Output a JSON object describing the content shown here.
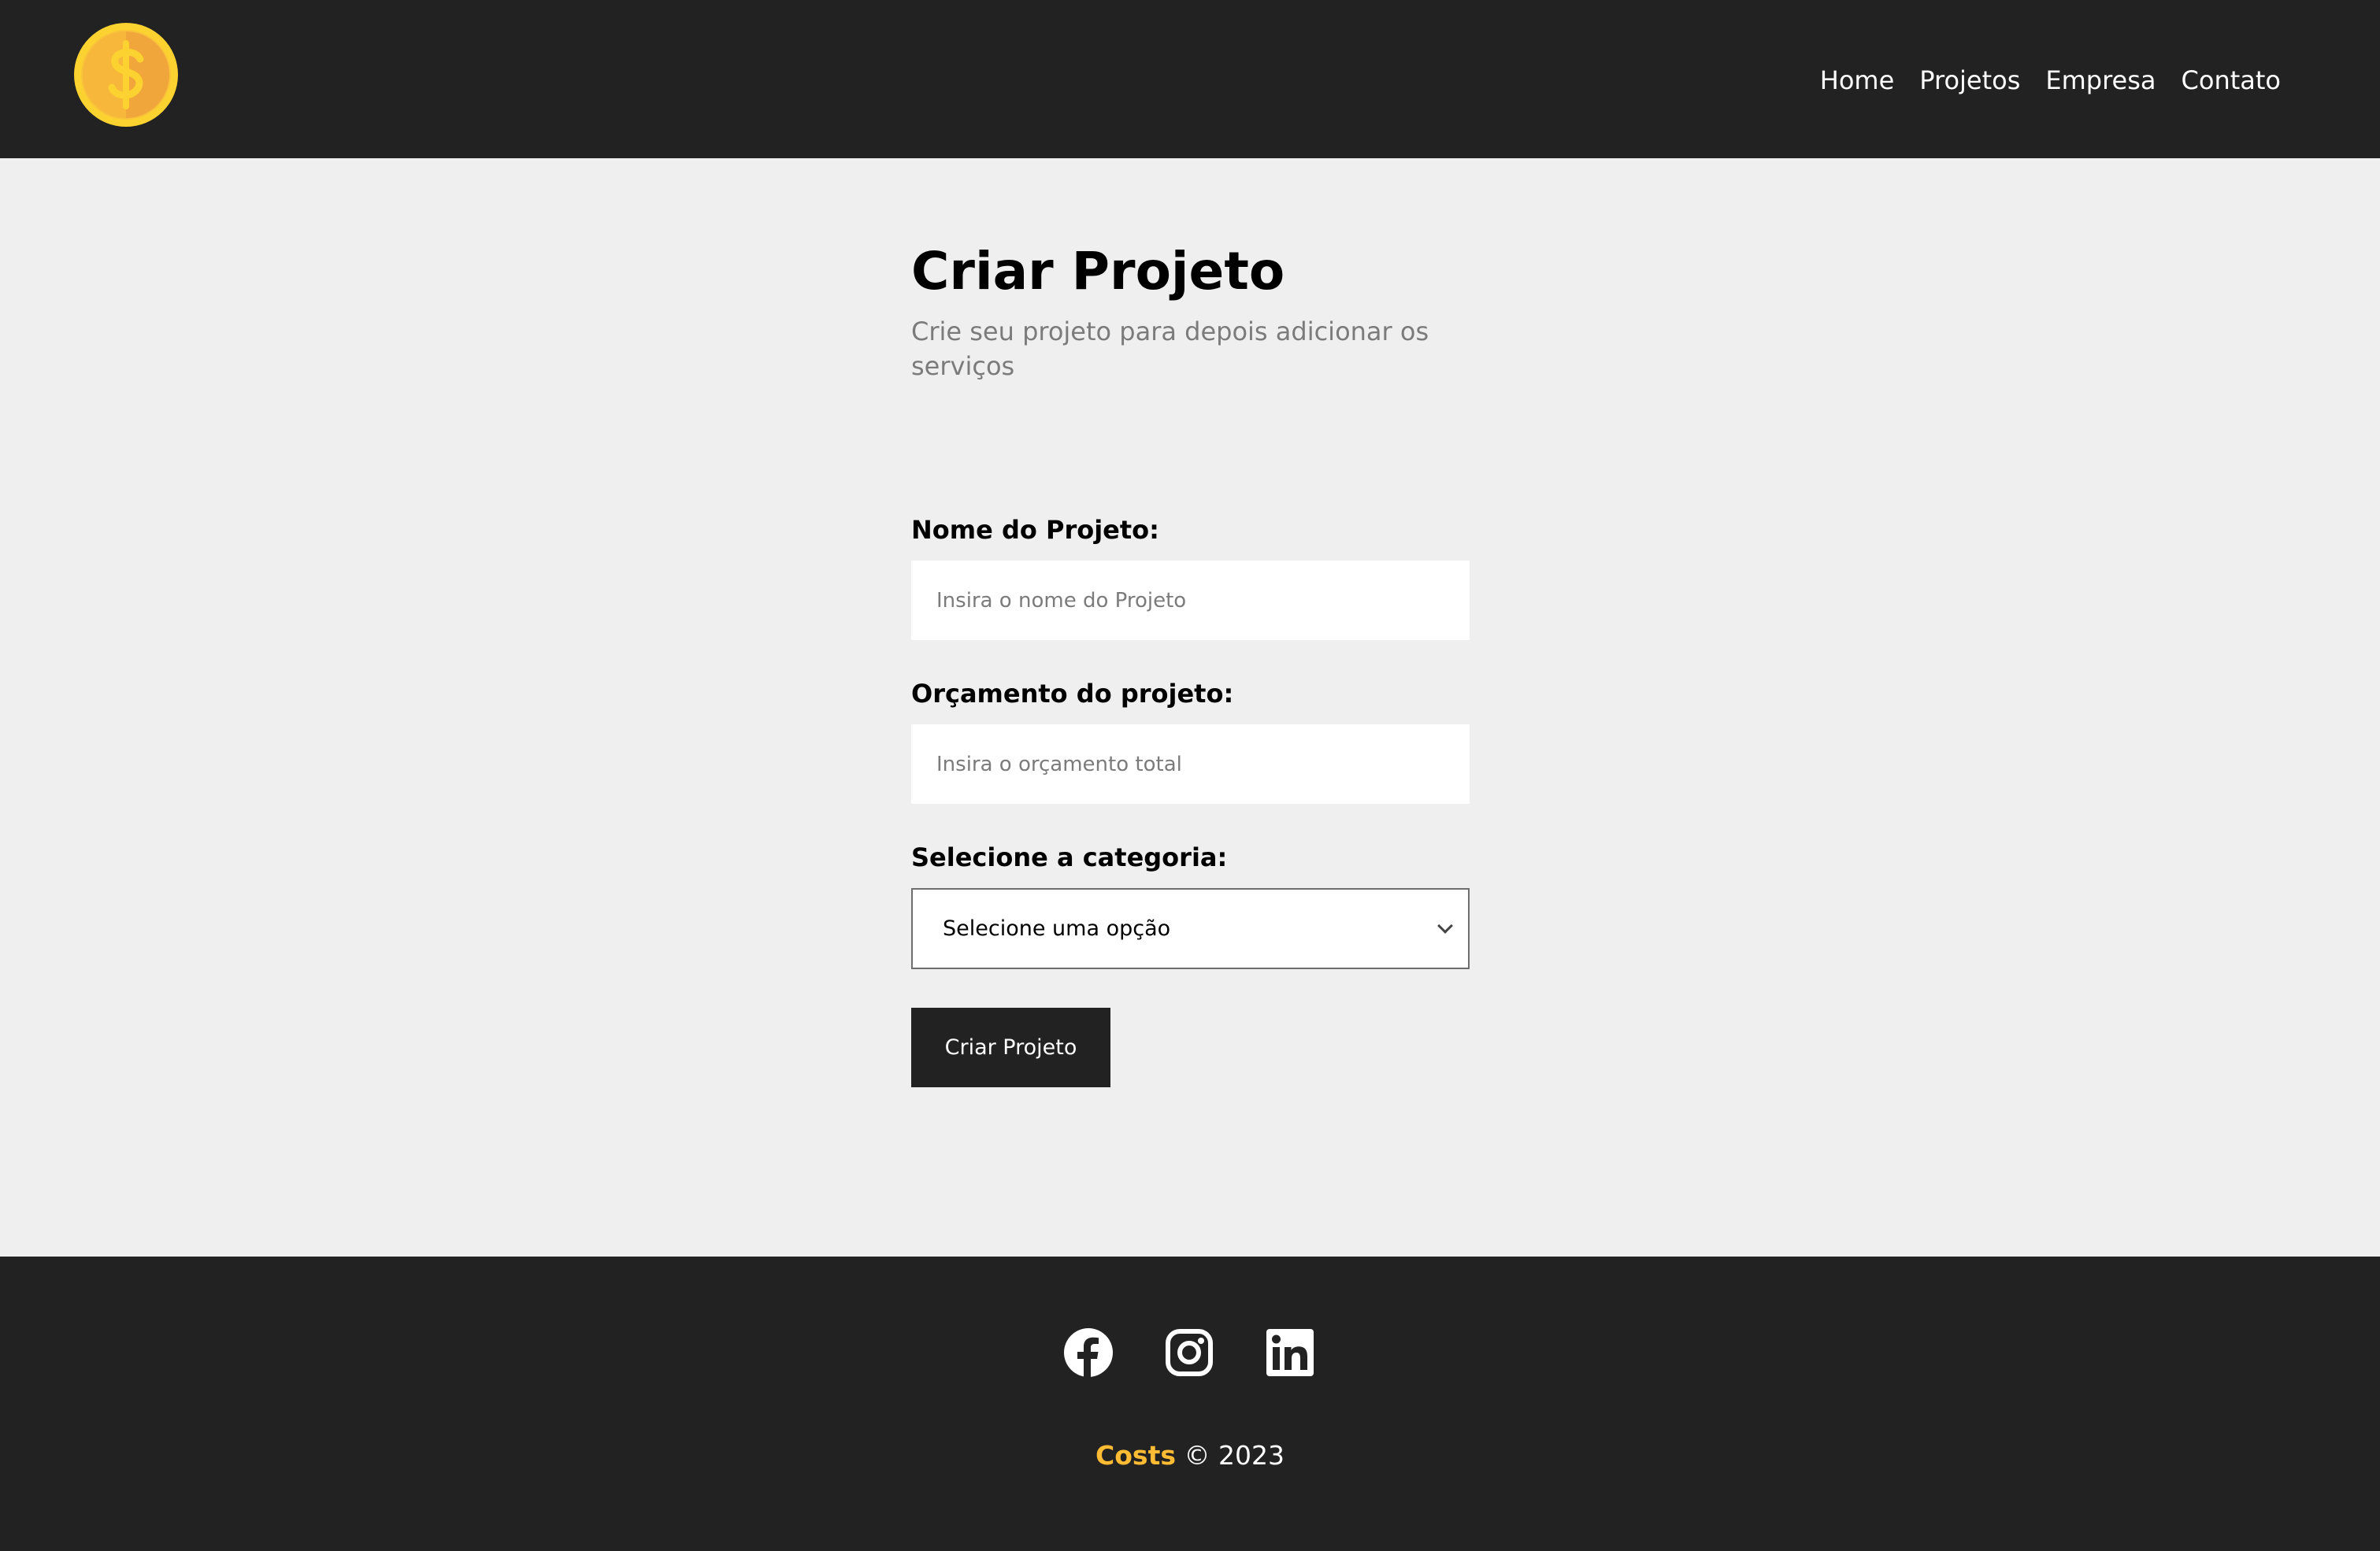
{
  "header": {
    "logo_icon": "dollar-coin-icon",
    "nav": [
      {
        "label": "Home"
      },
      {
        "label": "Projetos"
      },
      {
        "label": "Empresa"
      },
      {
        "label": "Contato"
      }
    ]
  },
  "form": {
    "title": "Criar Projeto",
    "subtitle": "Crie seu projeto para depois adicionar os serviços",
    "name_label": "Nome do Projeto:",
    "name_placeholder": "Insira o nome do Projeto",
    "budget_label": "Orçamento do projeto:",
    "budget_placeholder": "Insira o orçamento total",
    "category_label": "Selecione a categoria:",
    "category_selected": "Selecione uma opção",
    "submit_label": "Criar Projeto"
  },
  "footer": {
    "social_icons": [
      "facebook-icon",
      "instagram-icon",
      "linkedin-icon"
    ],
    "brand": "Costs",
    "copyright": "© 2023"
  },
  "colors": {
    "dark": "#222222",
    "background": "#efefef",
    "accent": "#ffbb33"
  }
}
